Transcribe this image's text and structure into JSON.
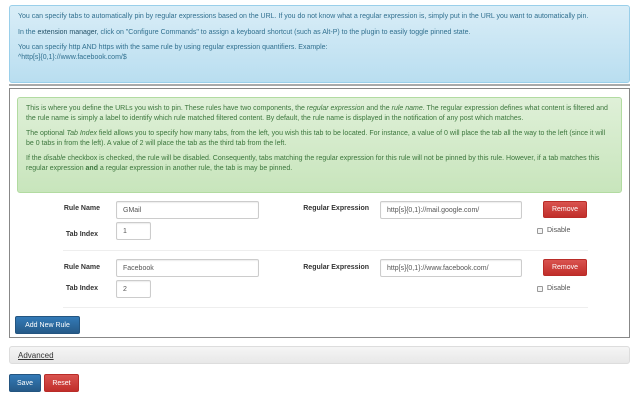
{
  "info": {
    "p1": "You can specify tabs to automatically pin by regular expressions based on the URL. If you do not know what a regular expression is, simply put in the URL you want to automatically pin.",
    "p2_before": "In the ",
    "p2_link": "extension manager",
    "p2_after": ", click on \"Configure Commands\" to assign a keyboard shortcut (such as Alt-P) to the plugin to easily toggle pinned state.",
    "p3": "You can specify http AND https with the same rule by using regular expression quantifiers. Example:",
    "p3_example": "^http[s]{0,1}://www.facebook.com/$"
  },
  "help": {
    "p1_a": "This is where you define the URLs you wish to pin. These rules have two components, the ",
    "p1_em1": "regular expression",
    "p1_b": " and the ",
    "p1_em2": "rule name",
    "p1_c": ". The regular expression defines what content is filtered and the rule name is simply a label to identify which rule matched filtered content. By default, the rule name is displayed in the notification of any post which matches.",
    "p2_a": "The optional ",
    "p2_em": "Tab Index",
    "p2_b": " field allows you to specify how many tabs, from the left, you wish this tab to be located. For instance, a value of 0 will place the tab all the way to the left (since it will be 0 tabs in from the left). A value of 2 will place the tab as the third tab from the left.",
    "p3_a": "If the ",
    "p3_em": "disable",
    "p3_b": " checkbox is checked, the rule will be disabled. Consequently, tabs matching the regular expression for this rule will not be pinned by this rule. However, if a tab matches this regular expression ",
    "p3_strong": "and",
    "p3_c": " a regular expression in another rule, the tab is may be pinned."
  },
  "labels": {
    "rule_name": "Rule Name",
    "regex": "Regular Expression",
    "tab_index": "Tab Index",
    "remove": "Remove",
    "disable": "Disable"
  },
  "rules": [
    {
      "name": "GMail",
      "regex": "http[s]{0,1}://mail.google.com/",
      "tab_index": "1",
      "disabled": false
    },
    {
      "name": "Facebook",
      "regex": "http[s]{0,1}://www.facebook.com/",
      "tab_index": "2",
      "disabled": false
    }
  ],
  "add_rule": "Add New Rule",
  "advanced": "Advanced",
  "save": "Save",
  "reset": "Reset"
}
